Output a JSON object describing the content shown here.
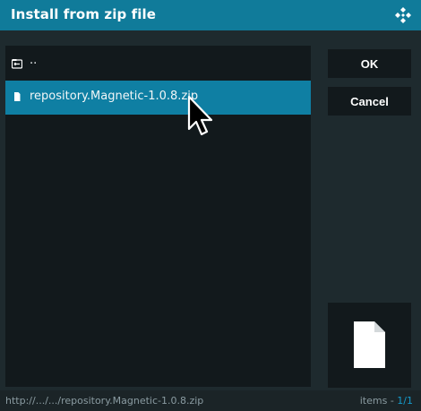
{
  "window": {
    "title": "Install from zip file",
    "icon": "kodi-logo-icon",
    "accent": "#107b9a"
  },
  "file_list": {
    "items": [
      {
        "label": "..",
        "icon": "parent-folder-icon",
        "selected": false
      },
      {
        "label": "repository.Magnetic-1.0.8.zip",
        "icon": "file-icon",
        "selected": true
      }
    ],
    "selected_color": "#0f7fa3"
  },
  "buttons": {
    "ok_label": "OK",
    "cancel_label": "Cancel"
  },
  "preview": {
    "icon": "file-icon"
  },
  "statusbar": {
    "path": "http://.../.../repository.Magnetic-1.0.8.zip",
    "items_label": "items",
    "separator": " - ",
    "items_count": "1/1",
    "count_color": "#159bcc"
  }
}
